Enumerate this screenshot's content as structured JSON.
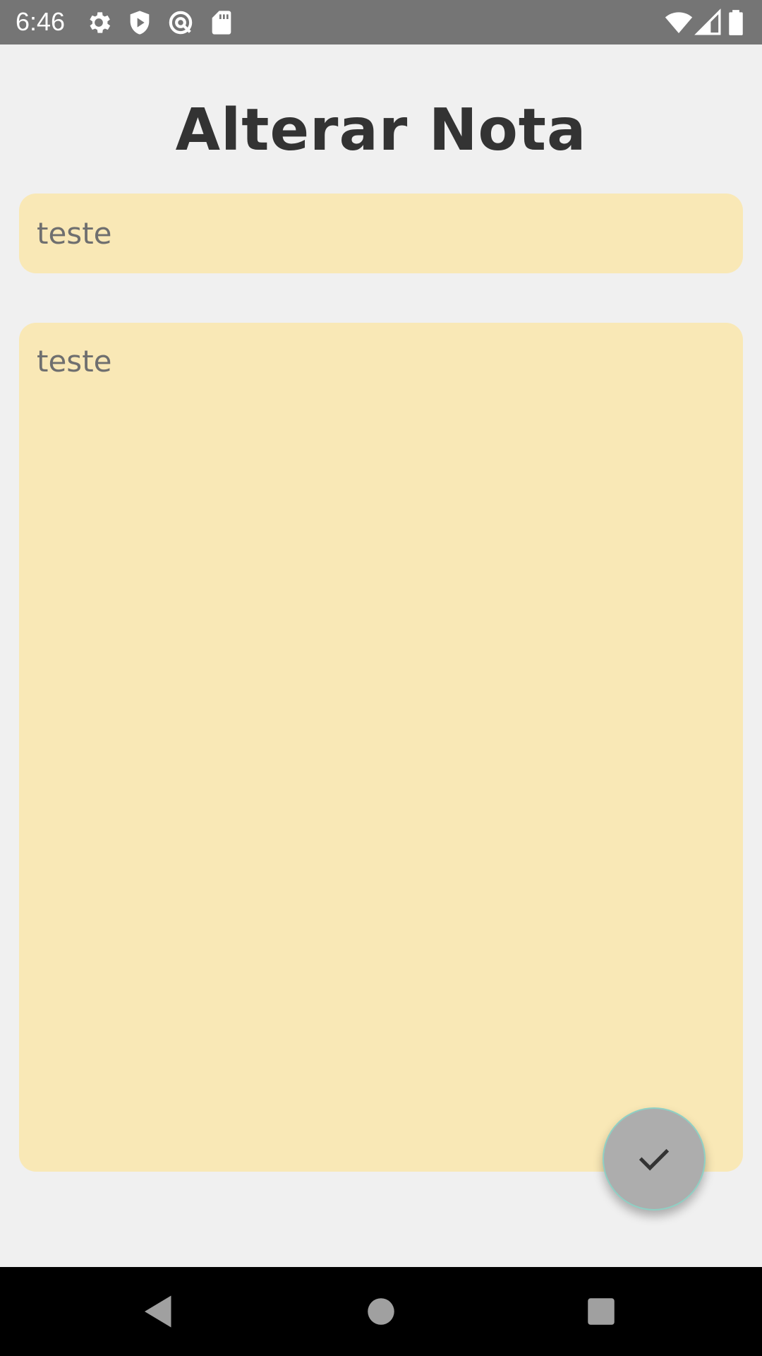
{
  "status_bar": {
    "time": "6:46",
    "icons_left": [
      "gear-icon",
      "shield-play-icon",
      "vpn-icon",
      "sd-card-icon"
    ],
    "icons_right": [
      "wifi-icon",
      "cell-signal-icon",
      "battery-icon"
    ]
  },
  "page": {
    "title": "Alterar Nota"
  },
  "note": {
    "title_value": "teste",
    "body_value": "teste"
  },
  "fab": {
    "icon": "check-icon"
  },
  "nav_bar": {
    "buttons": [
      "back-icon",
      "home-icon",
      "recents-icon"
    ]
  },
  "colors": {
    "status_bar": "#757575",
    "background": "#f0f0f0",
    "field_background": "#f9e8b6",
    "title_text": "#333333",
    "field_text": "#6f6f6f",
    "fab_background": "#adadad",
    "nav_bar": "#000000"
  }
}
